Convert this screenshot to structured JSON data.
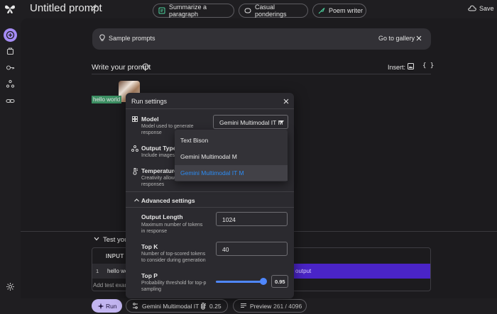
{
  "header": {
    "title": "Untitled prompt",
    "save_label": "Save"
  },
  "samples": {
    "label": "Sample prompts",
    "chips": [
      "Summarize a paragraph",
      "Casual ponderings",
      "Poem writer"
    ],
    "gallery_label": "Go to gallery"
  },
  "editor": {
    "title": "Write your prompt",
    "insert_label": "Insert:",
    "code_label": "{ }",
    "text": "hello world"
  },
  "test": {
    "label": "Test your prompt",
    "input_header": "INPUT",
    "row_number": "1",
    "row_input": "hello world",
    "output_placeholder": "output",
    "add_label": "Add test example"
  },
  "bottom": {
    "run_label": "Run",
    "model_label": "Gemini Multimodal IT M",
    "temperature": "0.25",
    "preview_label": "Preview",
    "tokens": "261 / 4096"
  },
  "run_settings": {
    "title": "Run settings",
    "model": {
      "title": "Model",
      "description": "Model used to generate response",
      "selected": "Gemini Multimodal IT M",
      "options": [
        "Text Bison",
        "Gemini Multimodal M",
        "Gemini Multimodal IT M"
      ]
    },
    "output_type": {
      "title": "Output Type",
      "description": "Include images in"
    },
    "temperature": {
      "title": "Temperature",
      "description_line1": "Creativity allowed",
      "description_line2": "responses"
    },
    "advanced": {
      "title": "Advanced settings",
      "output_length": {
        "title": "Output Length",
        "description": "Maximum number of tokens in response",
        "value": "1024"
      },
      "top_k": {
        "title": "Top K",
        "description": "Number of top-scored tokens to consider during generation",
        "value": "40"
      },
      "top_p": {
        "title": "Top P",
        "description": "Probability threshold for top-p sampling",
        "value": "0.95",
        "fraction": 0.95
      }
    }
  },
  "colors": {
    "accent_purple": "#a58cf5",
    "run_button": "#c2b5f0",
    "slider_blue": "#4f87ff",
    "selected_option": "#2c8cf5",
    "output_row": "#4a24c7"
  }
}
